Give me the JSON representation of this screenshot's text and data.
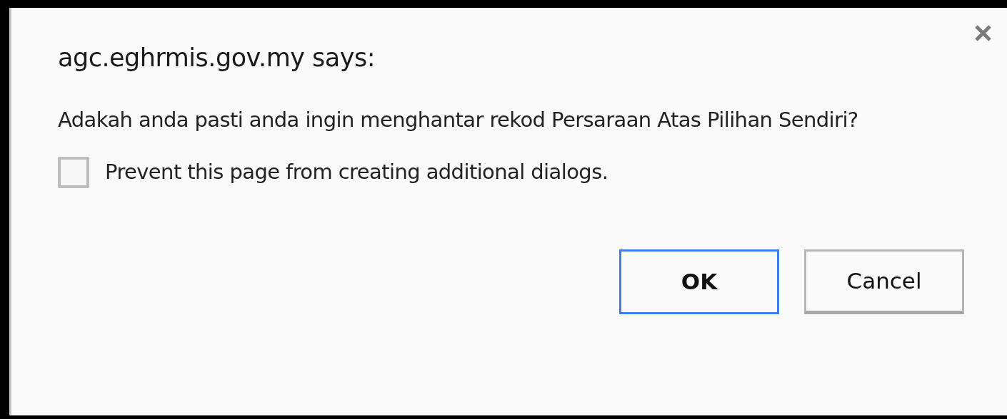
{
  "dialog": {
    "title": "agc.eghrmis.gov.my says:",
    "message": "Adakah anda pasti anda ingin menghantar rekod Persaraan Atas Pilihan Sendiri?",
    "checkbox": {
      "label": "Prevent this page from creating additional dialogs.",
      "checked": false
    },
    "buttons": [
      {
        "label": "OK",
        "kind": "primary"
      },
      {
        "label": "Cancel",
        "kind": "secondary"
      }
    ]
  }
}
